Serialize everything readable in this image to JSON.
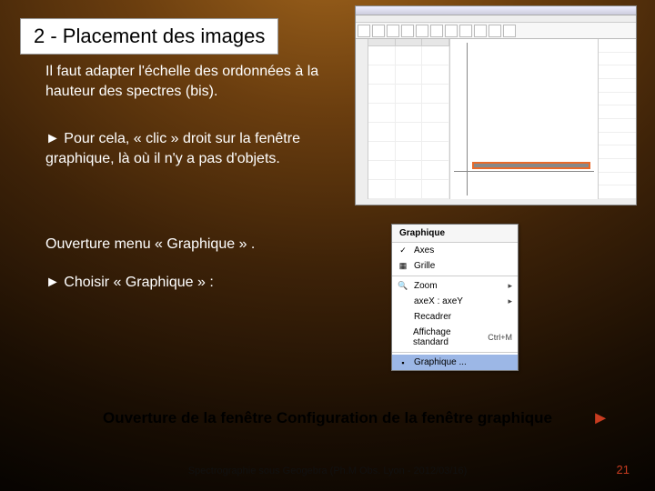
{
  "title": "2 - Placement des images",
  "paragraphs": {
    "p1": "Il faut adapter l'échelle des ordonnées à la hauteur des spectres (bis).",
    "p2": "► Pour cela, « clic » droit sur la fenêtre graphique, là où il n'y a pas d'objets.",
    "p3": "Ouverture menu « Graphique » .",
    "p4": "► Choisir « Graphique » :"
  },
  "bottom_line": "Ouverture de la fenêtre  Configuration de la fenêtre graphique",
  "bottom_arrow": "►",
  "footer": "Spectrographie sous Geogebra (Ph.M Obs. Lyon - 2012/03/16)",
  "page_num": "21",
  "context_menu": {
    "title": "Graphique",
    "items": {
      "axes": "Axes",
      "grid": "Grille",
      "zoom": "Zoom",
      "ratio": "axeX : axeY",
      "recenter": "Recadrer",
      "standard": "Affichage standard",
      "standard_shortcut": "Ctrl+M",
      "graphique": "Graphique ..."
    }
  }
}
